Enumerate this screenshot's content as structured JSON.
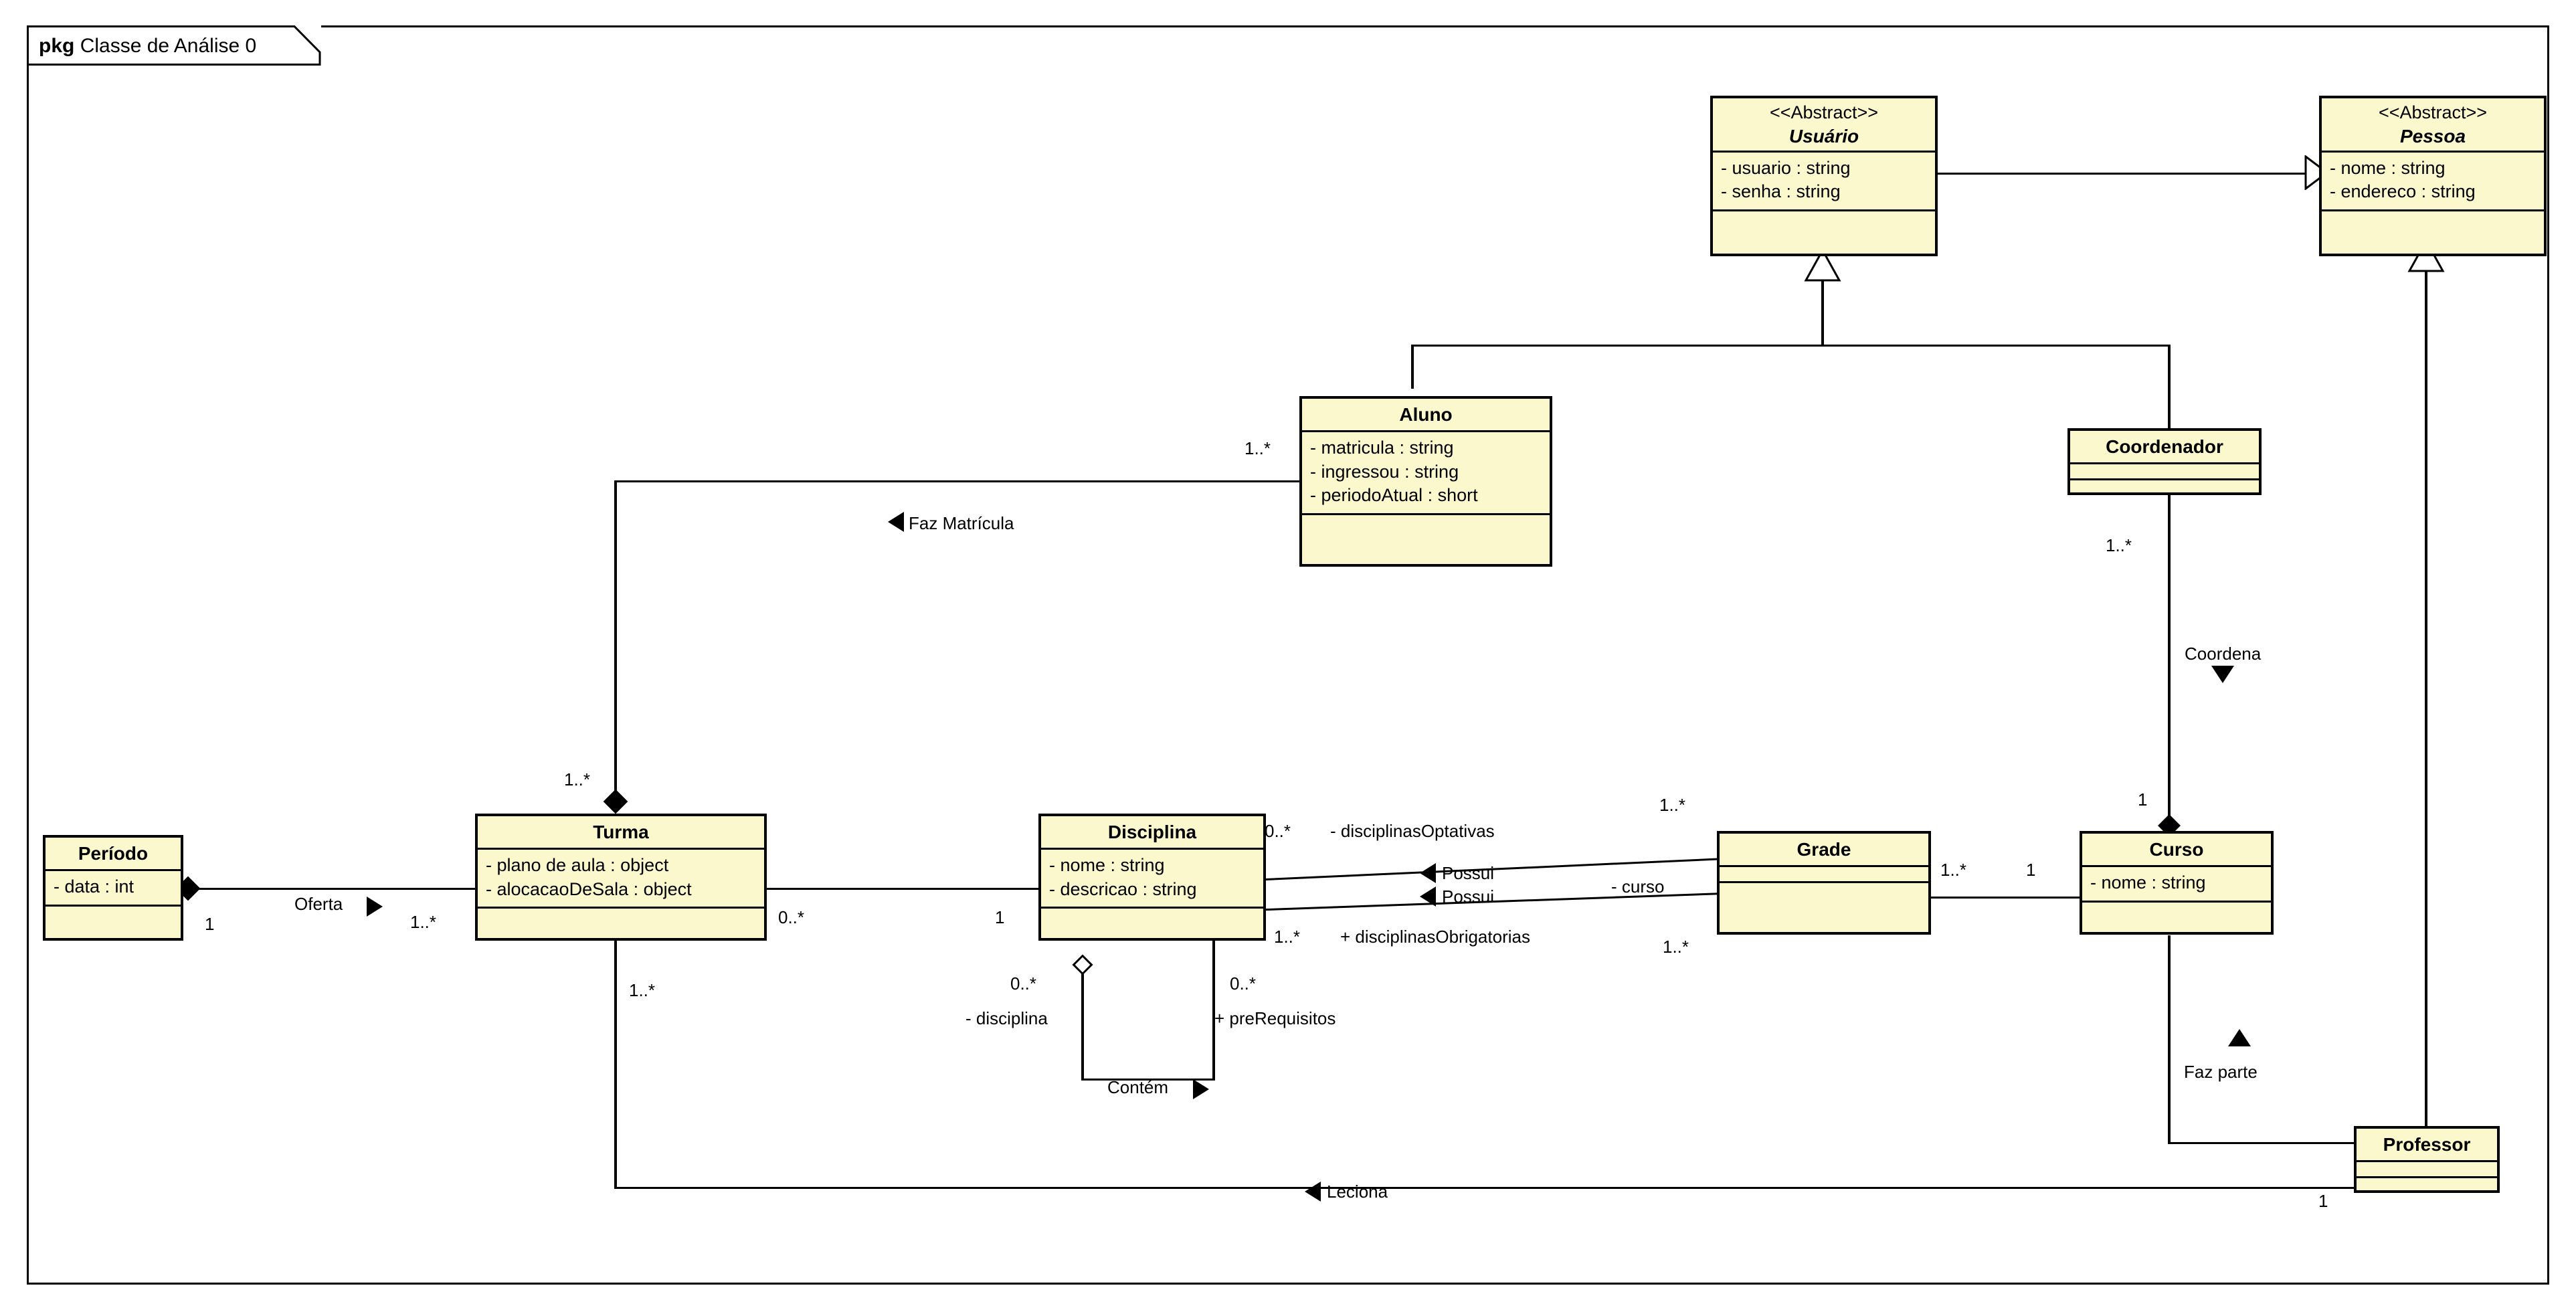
{
  "package": {
    "keyword": "pkg",
    "title": "Classe de Análise 0"
  },
  "colors": {
    "class_fill": "#fbf8cd",
    "stroke": "#000000",
    "background": "#ffffff"
  },
  "classes": {
    "usuario": {
      "stereotype": "<<Abstract>>",
      "name": "Usuário",
      "attributes": [
        "- usuario : string",
        "- senha : string"
      ],
      "operations": []
    },
    "pessoa": {
      "stereotype": "<<Abstract>>",
      "name": "Pessoa",
      "attributes": [
        "- nome : string",
        "- endereco : string"
      ],
      "operations": []
    },
    "aluno": {
      "name": "Aluno",
      "attributes": [
        "- matricula : string",
        "- ingressou : string",
        "- periodoAtual : short"
      ],
      "operations": []
    },
    "coordenador": {
      "name": "Coordenador",
      "attributes": [],
      "operations": []
    },
    "periodo": {
      "name": "Período",
      "attributes": [
        "- data : int"
      ],
      "operations": []
    },
    "turma": {
      "name": "Turma",
      "attributes": [
        "- plano de aula : object",
        "- alocacaoDeSala : object"
      ],
      "operations": []
    },
    "disciplina": {
      "name": "Disciplina",
      "attributes": [
        "- nome : string",
        "- descricao : string"
      ],
      "operations": []
    },
    "grade": {
      "name": "Grade",
      "attributes": [],
      "operations": []
    },
    "curso": {
      "name": "Curso",
      "attributes": [
        "- nome : string"
      ],
      "operations": []
    },
    "professor": {
      "name": "Professor",
      "attributes": [],
      "operations": []
    }
  },
  "relations": {
    "usuario_pessoa": {
      "label": "",
      "kind": "generalization"
    },
    "aluno_usuario": {
      "label": "",
      "kind": "generalization"
    },
    "coordenador_usuario": {
      "label": "",
      "kind": "generalization"
    },
    "professor_pessoa": {
      "label": "",
      "kind": "generalization"
    },
    "faz_matricula": {
      "label": "Faz Matrícula",
      "direction": "left",
      "source_mult": "1..*",
      "target_mult": "1..*",
      "kind": "composition"
    },
    "oferta": {
      "label": "Oferta",
      "direction": "right",
      "source_mult": "1",
      "target_mult": "1..*",
      "kind": "composition"
    },
    "turma_disciplina": {
      "label": "",
      "source_mult": "0..*",
      "target_mult": "1",
      "kind": "association"
    },
    "possui_optativas": {
      "label": "Possui",
      "direction": "left",
      "source_mult": "0..*",
      "source_role": "- disciplinasOptativas",
      "target_mult": "1..*",
      "kind": "association"
    },
    "possui_obrigatorias": {
      "label": "Possui",
      "direction": "left",
      "source_mult": "1..*",
      "source_role": "+ disciplinasObrigatorias",
      "target_mult": "1..*",
      "kind": "association"
    },
    "grade_curso": {
      "label": "",
      "source_mult": "1..*",
      "target_mult": "1",
      "role": "- curso",
      "kind": "association"
    },
    "contem": {
      "label": "Contém",
      "direction": "right",
      "source_mult": "0..*",
      "source_role": "- disciplina",
      "target_mult": "0..*",
      "target_role": "+ preRequisitos",
      "kind": "aggregation"
    },
    "coordena": {
      "label": "Coordena",
      "direction": "down",
      "source_mult": "1..*",
      "target_mult": "1",
      "kind": "composition"
    },
    "faz_parte": {
      "label": "Faz parte",
      "direction": "up",
      "source_mult": "",
      "target_mult": "",
      "kind": "association"
    },
    "leciona": {
      "label": "Leciona",
      "direction": "left",
      "source_mult": "1..*",
      "target_mult": "1",
      "kind": "association"
    }
  },
  "multiplicity_labels": {
    "faz_matricula_aluno": "1..*",
    "faz_matricula_turma": "1..*",
    "oferta_periodo": "1",
    "oferta_turma": "1..*",
    "turma_right": "0..*",
    "disciplina_left": "1",
    "disciplina_optativas": "0..*",
    "disciplina_obrigatorias": "1..*",
    "grade_left_top": "1..*",
    "grade_left_bottom": "1..*",
    "grade_right": "1..*",
    "curso_left": "1",
    "contem_left": "0..*",
    "contem_right": "0..*",
    "coordenador_bottom": "1..*",
    "curso_top": "1",
    "leciona_turma": "1..*",
    "leciona_professor": "1"
  },
  "role_labels": {
    "disciplinas_optativas": "- disciplinasOptativas",
    "disciplinas_obrigatorias": "+ disciplinasObrigatorias",
    "curso_role": "- curso",
    "disciplina_role": "- disciplina",
    "prerequisitos_role": "+ preRequisitos"
  }
}
